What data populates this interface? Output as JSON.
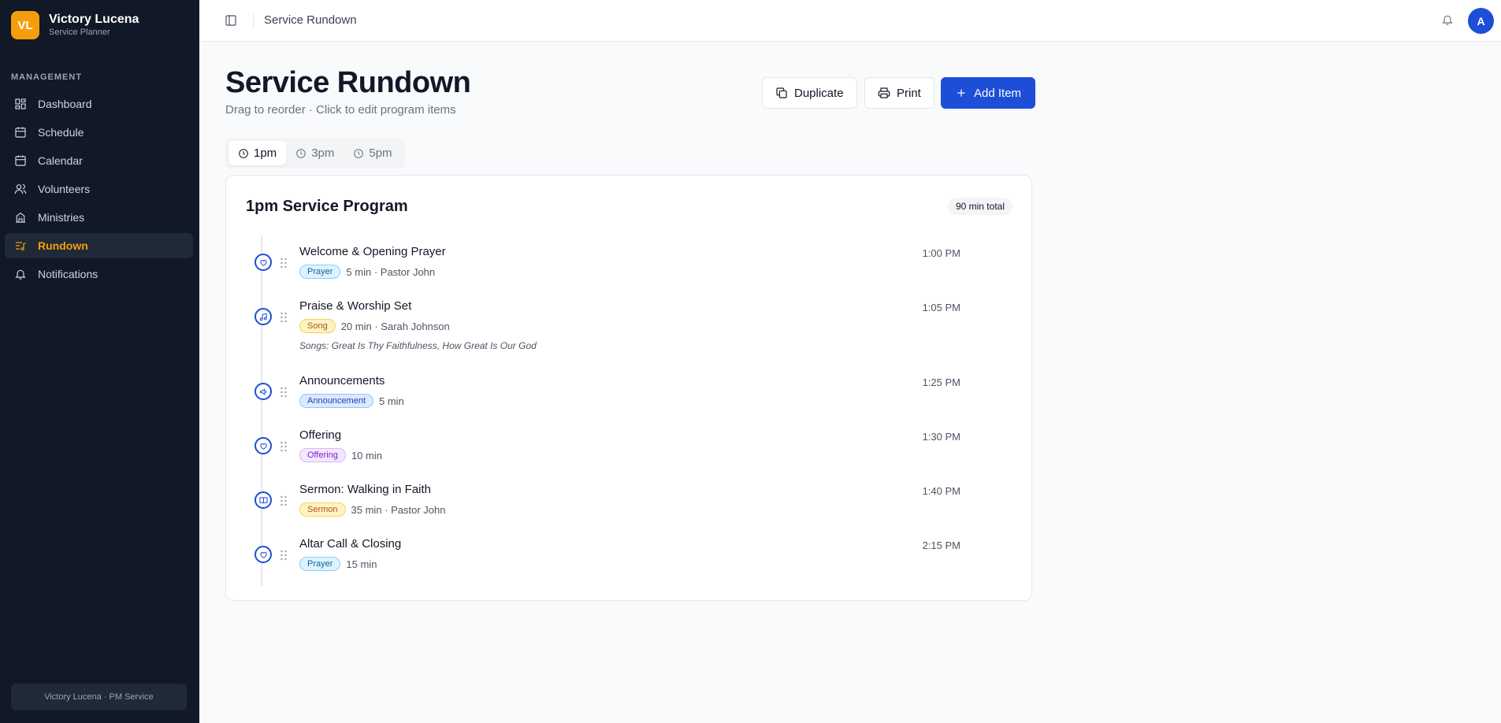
{
  "sidebar": {
    "brand_initials": "VL",
    "brand_name": "Victory Lucena",
    "brand_sub": "Service Planner",
    "section_label": "MANAGEMENT",
    "items": [
      {
        "label": "Dashboard",
        "icon": "grid-icon"
      },
      {
        "label": "Schedule",
        "icon": "calendar-icon"
      },
      {
        "label": "Calendar",
        "icon": "calendar-icon"
      },
      {
        "label": "Volunteers",
        "icon": "users-icon"
      },
      {
        "label": "Ministries",
        "icon": "building-icon"
      },
      {
        "label": "Rundown",
        "icon": "list-music-icon",
        "active": true
      },
      {
        "label": "Notifications",
        "icon": "bell-icon"
      }
    ],
    "footer": "Victory Lucena · PM Service"
  },
  "header": {
    "title": "Service Rundown",
    "avatar": "A"
  },
  "main": {
    "title": "Service Rundown",
    "subtitle": "Drag to reorder · Click to edit program items",
    "buttons": {
      "duplicate": "Duplicate",
      "print": "Print",
      "add": "Add Item"
    },
    "tabs": [
      {
        "label": "1pm",
        "active": true
      },
      {
        "label": "3pm"
      },
      {
        "label": "5pm"
      }
    ]
  },
  "program": {
    "title": "1pm Service Program",
    "total": "90 min total",
    "items": [
      {
        "title": "Welcome & Opening Prayer",
        "tag": "Prayer",
        "duration": "5 min",
        "person": "· Pastor John",
        "time": "1:00 PM",
        "icon": "heart-icon"
      },
      {
        "title": "Praise & Worship Set",
        "tag": "Song",
        "duration": "20 min",
        "person": "· Sarah Johnson",
        "notes": "Songs: Great Is Thy Faithfulness, How Great Is Our God",
        "time": "1:05 PM",
        "icon": "music-icon"
      },
      {
        "title": "Announcements",
        "tag": "Announcement",
        "duration": "5 min",
        "person": "",
        "time": "1:25 PM",
        "icon": "megaphone-icon"
      },
      {
        "title": "Offering",
        "tag": "Offering",
        "duration": "10 min",
        "person": "",
        "time": "1:30 PM",
        "icon": "heart-icon"
      },
      {
        "title": "Sermon: Walking in Faith",
        "tag": "Sermon",
        "duration": "35 min",
        "person": "· Pastor John",
        "time": "1:40 PM",
        "icon": "book-icon"
      },
      {
        "title": "Altar Call & Closing",
        "tag": "Prayer",
        "duration": "15 min",
        "person": "",
        "time": "2:15 PM",
        "icon": "heart-icon"
      }
    ]
  }
}
